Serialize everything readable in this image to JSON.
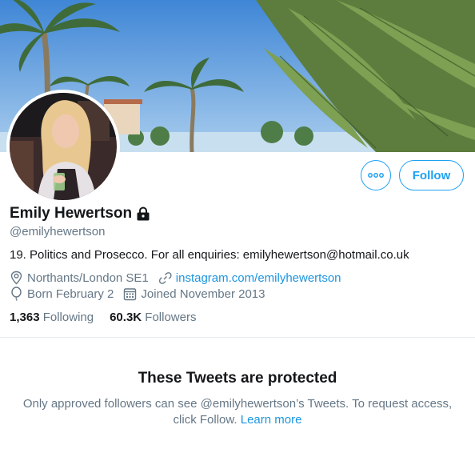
{
  "profile": {
    "display_name": "Emily Hewertson",
    "handle": "@emilyhewertson",
    "bio": "19. Politics and Prosecco. For all enquiries: emilyhewertson@hotmail.co.uk",
    "location": "Northants/London SE1",
    "website": "instagram.com/emilyhewertson",
    "birthday": "Born February 2",
    "joined": "Joined November 2013"
  },
  "stats": {
    "following_count": "1,363",
    "following_label": "Following",
    "followers_count": "60.3K",
    "followers_label": "Followers"
  },
  "actions": {
    "follow_label": "Follow"
  },
  "protected": {
    "title": "These Tweets are protected",
    "message": "Only approved followers can see @emilyhewertson’s Tweets. To request access, click Follow.",
    "learn_more": "Learn more"
  },
  "icons": {
    "more": "more-options-icon",
    "lock": "lock-icon",
    "location": "location-pin-icon",
    "link": "link-icon",
    "birthday": "balloon-icon",
    "calendar": "calendar-icon"
  },
  "colors": {
    "accent": "#1da1f2",
    "link": "#1b95e0",
    "secondary_text": "#657786",
    "primary_text": "#14171a",
    "divider": "#e6ecf0"
  }
}
